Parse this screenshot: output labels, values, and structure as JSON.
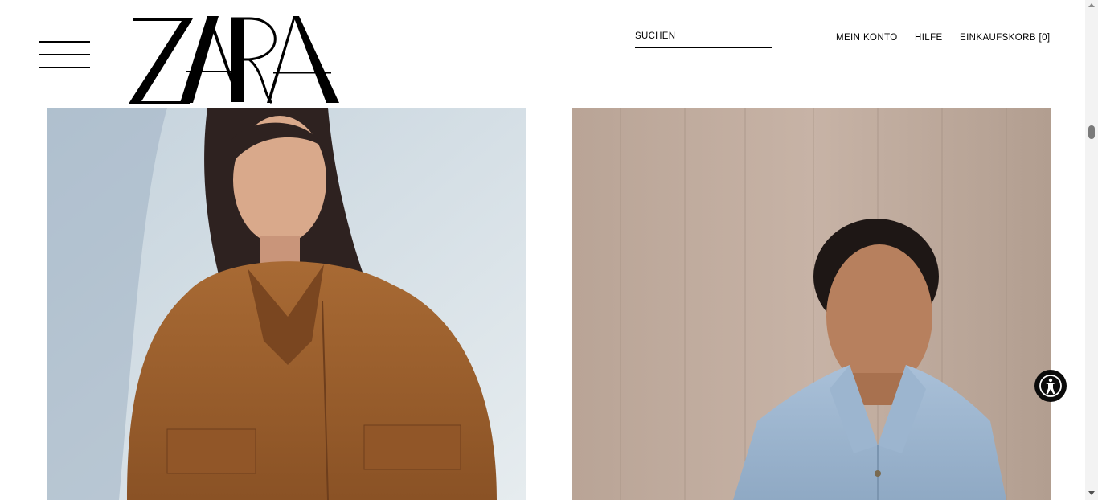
{
  "header": {
    "logo_text": "ZARA",
    "search_placeholder": "SUCHEN",
    "nav": {
      "account": "MEIN KONTO",
      "help": "HILFE",
      "cart": "EINKAUFSKORB [0]"
    }
  },
  "icons": {
    "menu": "hamburger-menu-icon",
    "accessibility": "accessibility-icon"
  },
  "colors": {
    "background": "#ffffff",
    "text": "#000000",
    "accessibility_button": "#0b0b0b"
  }
}
